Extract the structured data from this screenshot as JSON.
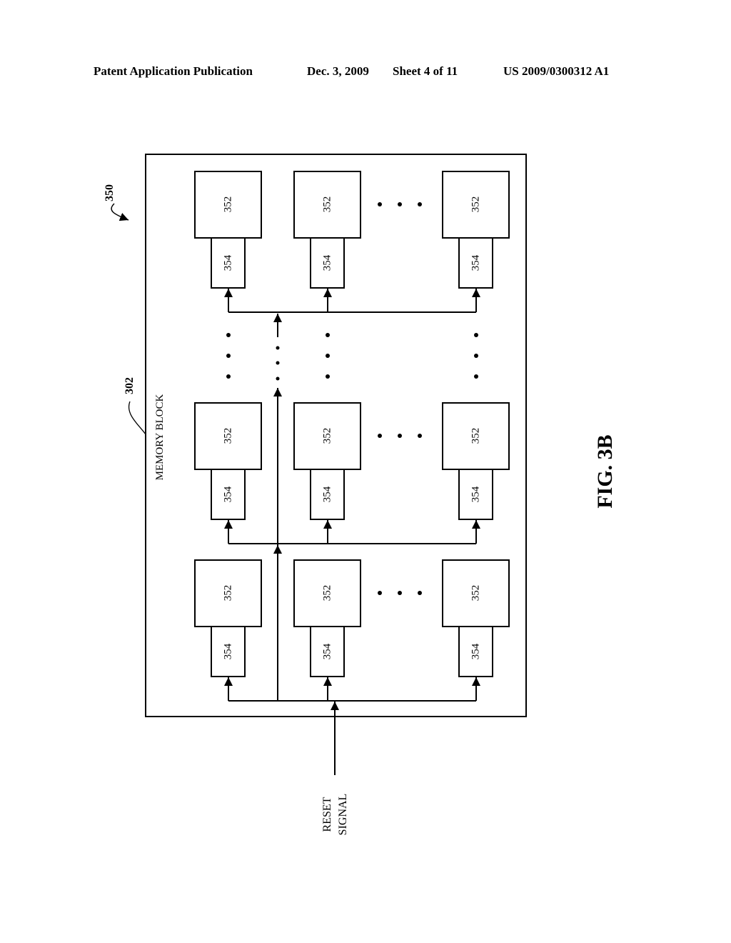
{
  "header": {
    "publication": "Patent Application Publication",
    "date": "Dec. 3, 2009",
    "sheet": "Sheet 4 of 11",
    "number": "US 2009/0300312 A1"
  },
  "figure": {
    "caption": "FIG. 3B",
    "ref_overall": "350",
    "ref_block": "302",
    "block_label": "MEMORY BLOCK",
    "input_label_line1": "RESET",
    "input_label_line2": "SIGNAL",
    "cell_label": "352",
    "reset_unit_label": "354",
    "rows": 3,
    "columns_shown": 3,
    "ellipsis": "• • •"
  }
}
